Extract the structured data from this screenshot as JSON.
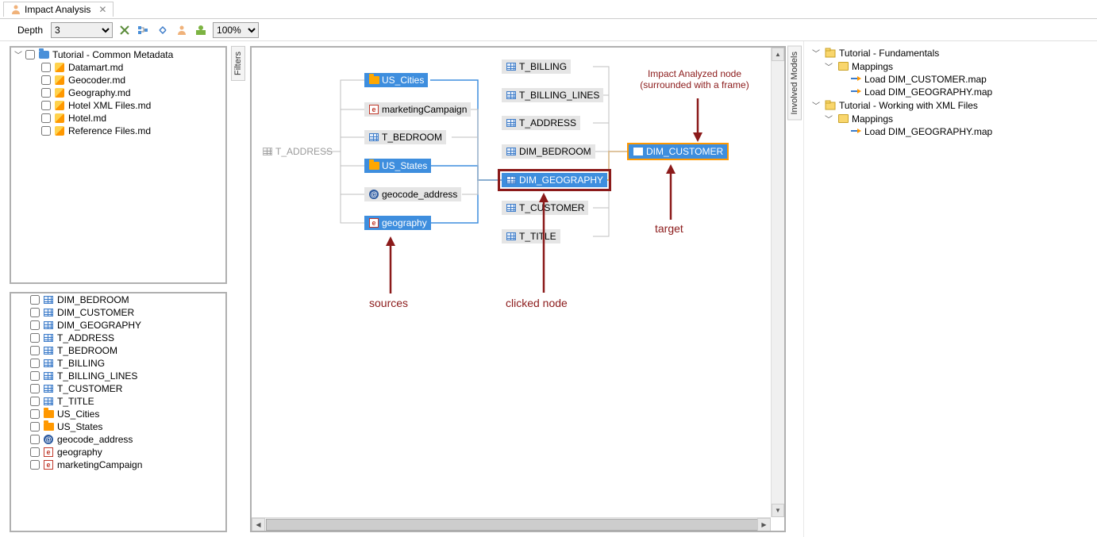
{
  "tab": {
    "title": "Impact Analysis"
  },
  "toolbar": {
    "depth_label": "Depth",
    "depth_value": "3",
    "zoom_value": "100%"
  },
  "leftTree": {
    "root": "Tutorial - Common Metadata",
    "items": [
      "Datamart.md",
      "Geocoder.md",
      "Geography.md",
      "Hotel XML Files.md",
      "Hotel.md",
      "Reference Files.md"
    ]
  },
  "objectList": [
    {
      "icon": "table",
      "label": "DIM_BEDROOM"
    },
    {
      "icon": "table",
      "label": "DIM_CUSTOMER"
    },
    {
      "icon": "table",
      "label": "DIM_GEOGRAPHY"
    },
    {
      "icon": "table",
      "label": "T_ADDRESS"
    },
    {
      "icon": "table",
      "label": "T_BEDROOM"
    },
    {
      "icon": "table",
      "label": "T_BILLING"
    },
    {
      "icon": "table",
      "label": "T_BILLING_LINES"
    },
    {
      "icon": "table",
      "label": "T_CUSTOMER"
    },
    {
      "icon": "table",
      "label": "T_TITLE"
    },
    {
      "icon": "folderOrange",
      "label": "US_Cities"
    },
    {
      "icon": "folderOrange",
      "label": "US_States"
    },
    {
      "icon": "at",
      "label": "geocode_address"
    },
    {
      "icon": "e",
      "label": "geography"
    },
    {
      "icon": "e",
      "label": "marketingCampaign"
    }
  ],
  "filtersLabel": "Filters",
  "involvedLabel": "Involved Models",
  "diagram": {
    "col0": {
      "t_address": "T_ADDRESS"
    },
    "col1": [
      {
        "id": "us_cities",
        "icon": "folderOrange",
        "label": "US_Cities",
        "hl": true
      },
      {
        "id": "marketing",
        "icon": "e",
        "label": "marketingCampaign",
        "hl": false
      },
      {
        "id": "t_bedroom",
        "icon": "table",
        "label": "T_BEDROOM",
        "hl": false
      },
      {
        "id": "us_states",
        "icon": "folderOrange",
        "label": "US_States",
        "hl": true
      },
      {
        "id": "geocode",
        "icon": "at",
        "label": "geocode_address",
        "hl": false
      },
      {
        "id": "geography",
        "icon": "e",
        "label": "geography",
        "hl": true
      }
    ],
    "col2": [
      {
        "id": "t_billing",
        "label": "T_BILLING"
      },
      {
        "id": "t_billing_lines",
        "label": "T_BILLING_LINES"
      },
      {
        "id": "t_address2",
        "label": "T_ADDRESS"
      },
      {
        "id": "dim_bedroom",
        "label": "DIM_BEDROOM"
      },
      {
        "id": "dim_geography",
        "label": "DIM_GEOGRAPHY",
        "framed": true,
        "hl": true
      },
      {
        "id": "t_customer",
        "label": "T_CUSTOMER"
      },
      {
        "id": "t_title",
        "label": "T_TITLE"
      }
    ],
    "target": {
      "label": "DIM_CUSTOMER"
    },
    "annotations": {
      "impact": "Impact Analyzed node",
      "impact2": "(surrounded with a frame)",
      "target": "target",
      "clicked": "clicked node",
      "sources": "sources"
    }
  },
  "rightTree": [
    {
      "type": "project",
      "label": "Tutorial - Fundamentals",
      "children": [
        {
          "type": "folder",
          "label": "Mappings",
          "children": [
            {
              "type": "map",
              "label": "Load DIM_CUSTOMER.map"
            },
            {
              "type": "map",
              "label": "Load DIM_GEOGRAPHY.map"
            }
          ]
        }
      ]
    },
    {
      "type": "project",
      "label": "Tutorial - Working with XML Files",
      "children": [
        {
          "type": "folder",
          "label": "Mappings",
          "children": [
            {
              "type": "map",
              "label": "Load DIM_GEOGRAPHY.map"
            }
          ]
        }
      ]
    }
  ]
}
